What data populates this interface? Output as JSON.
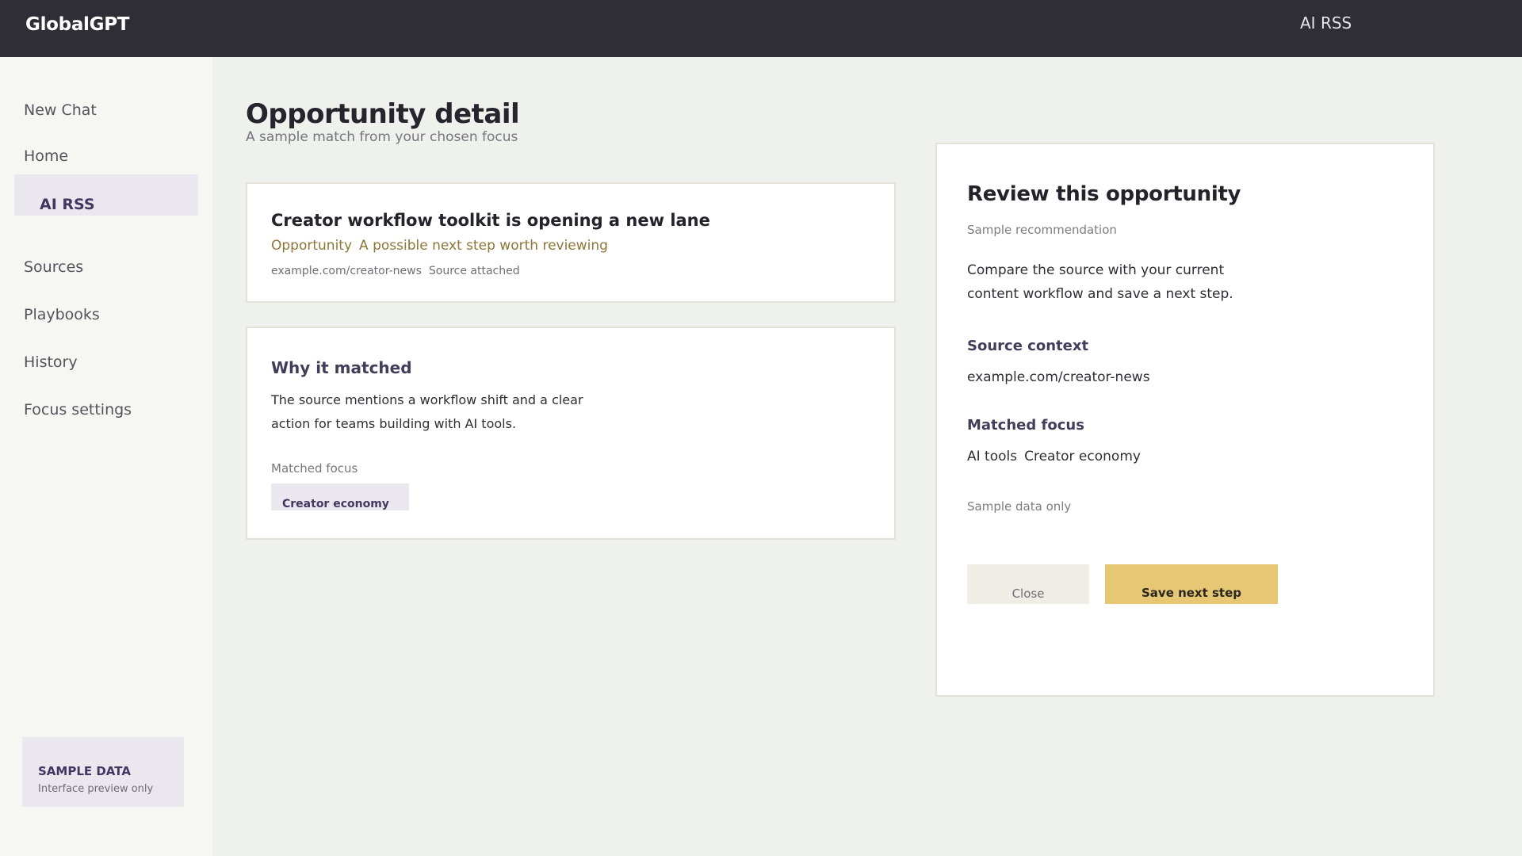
{
  "header": {
    "brand": "GlobalGPT",
    "active_section": "AI RSS"
  },
  "sidebar": {
    "items": [
      {
        "label": "New Chat"
      },
      {
        "label": "Home"
      },
      {
        "label": "AI RSS",
        "active": true
      },
      {
        "label": "Sources"
      },
      {
        "label": "Playbooks"
      },
      {
        "label": "History"
      },
      {
        "label": "Focus settings"
      }
    ],
    "sample": {
      "title": "SAMPLE DATA",
      "subtitle": "Interface preview only"
    }
  },
  "main": {
    "title": "Opportunity detail",
    "subtitle": "A sample match from your chosen focus",
    "opportunity": {
      "title": "Creator workflow toolkit is opening a new lane",
      "type": "Opportunity",
      "summary": "A possible next step worth reviewing",
      "source": "example.com/creator-news",
      "source_status": "Source attached"
    },
    "why": {
      "title": "Why it matched",
      "body": "The source mentions a workflow shift and a clear action for teams building with AI tools.",
      "focus_label": "Matched focus",
      "focus_chip": "Creator economy"
    }
  },
  "panel": {
    "title": "Review this opportunity",
    "subtitle": "Sample recommendation",
    "body": "Compare the source with your current content workflow and save a next step.",
    "source_context_heading": "Source context",
    "source_context_value": "example.com/creator-news",
    "matched_focus_heading": "Matched focus",
    "matched_focus_values": [
      "AI tools",
      "Creator economy"
    ],
    "note": "Sample data only",
    "close_label": "Close",
    "save_label": "Save next step"
  },
  "colors": {
    "topbar": "#2f2d35",
    "accent_purple": "#403860",
    "accent_gold": "#e5c774",
    "meta_gold": "#8f7635",
    "page_bg": "#eef1ec"
  }
}
